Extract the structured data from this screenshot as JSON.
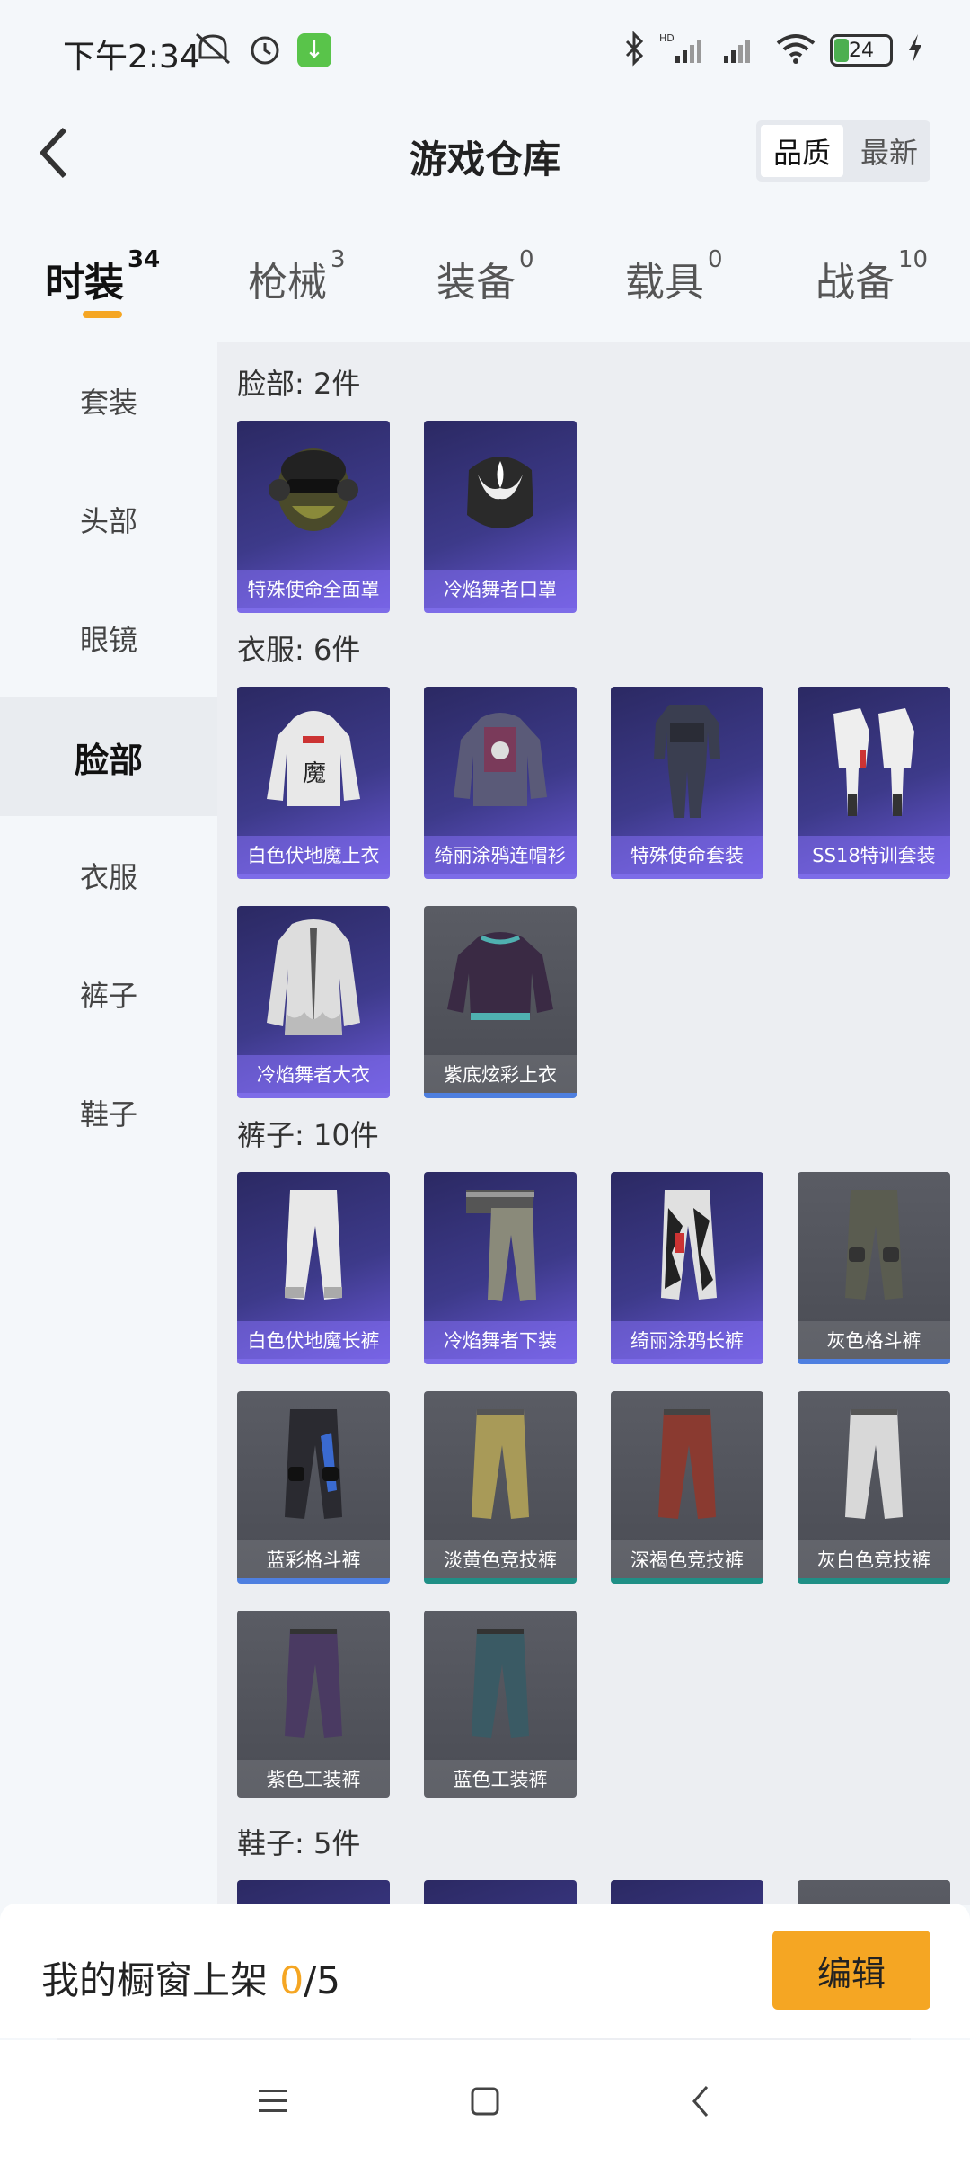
{
  "status_bar": {
    "time": "下午2:34",
    "battery": "24",
    "icons": [
      "mute-icon",
      "alarm-icon",
      "download-badge-icon",
      "bluetooth-icon",
      "hd-signal-icon",
      "signal-icon",
      "wifi-icon",
      "battery-icon",
      "charging-icon"
    ]
  },
  "header": {
    "title": "游戏仓库",
    "sort_options": [
      "品质",
      "最新"
    ],
    "active_sort": "品质"
  },
  "tabs": [
    {
      "label": "时装",
      "count": "34"
    },
    {
      "label": "枪械",
      "count": "3"
    },
    {
      "label": "装备",
      "count": "0"
    },
    {
      "label": "载具",
      "count": "0"
    },
    {
      "label": "战备",
      "count": "10"
    }
  ],
  "sidebar": [
    "套装",
    "头部",
    "眼镜",
    "脸部",
    "衣服",
    "裤子",
    "鞋子"
  ],
  "sections": {
    "face": {
      "title": "脸部: 2件",
      "items": [
        "特殊使命全面罩",
        "冷焰舞者口罩"
      ]
    },
    "clothes": {
      "title": "衣服: 6件",
      "items": [
        "白色伏地魔上衣",
        "绮丽涂鸦连帽衫",
        "特殊使命套装",
        "SS18特训套装",
        "冷焰舞者大衣",
        "紫底炫彩上衣"
      ]
    },
    "pants": {
      "title": "裤子: 10件",
      "items": [
        "白色伏地魔长裤",
        "冷焰舞者下装",
        "绮丽涂鸦长裤",
        "灰色格斗裤",
        "蓝彩格斗裤",
        "淡黄色竞技裤",
        "深褐色竞技裤",
        "灰白色竞技裤",
        "紫色工装裤",
        "蓝色工装裤"
      ]
    },
    "shoes": {
      "title": "鞋子: 5件"
    }
  },
  "showcase": {
    "label": "我的橱窗上架 ",
    "current": "0",
    "total": "/5",
    "edit_label": "编辑"
  },
  "colors": {
    "accent": "#f5a623",
    "epic": "#7d6ce8",
    "rare_blue": "#4e7fe0",
    "uncommon_teal": "#1f8f86"
  }
}
